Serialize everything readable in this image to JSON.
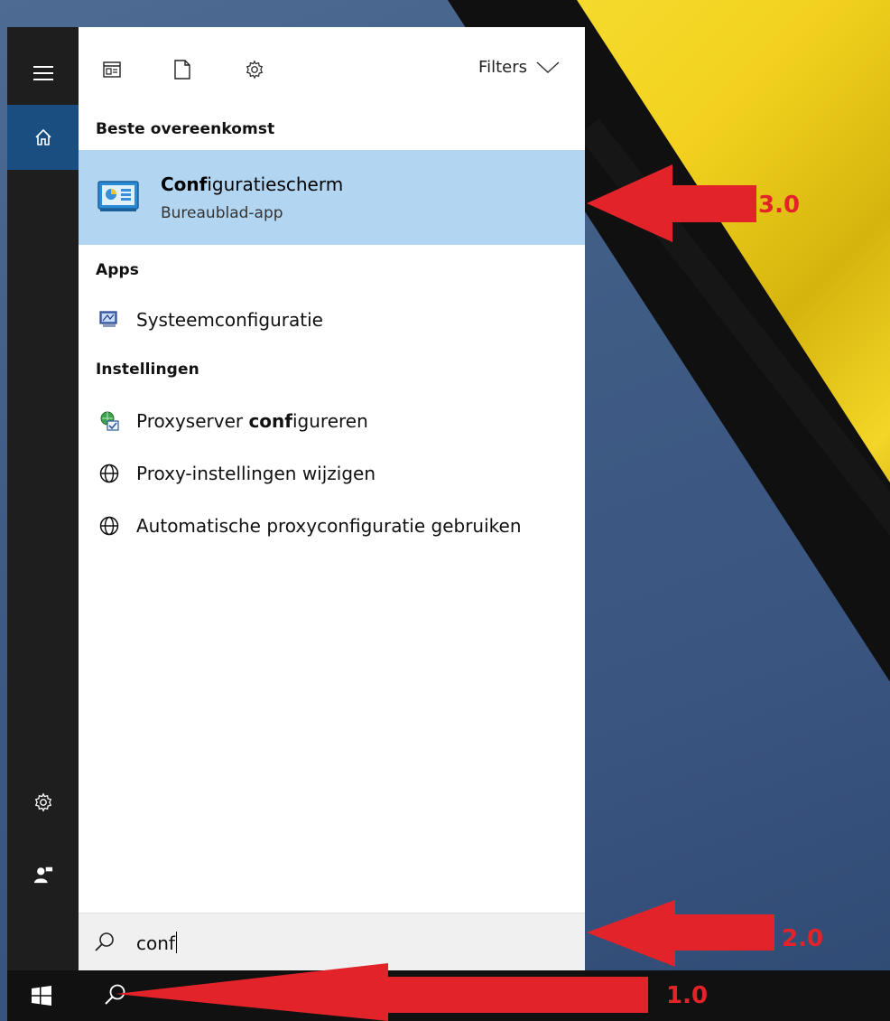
{
  "toolbar": {
    "filters_label": "Filters",
    "icons": [
      "apps-icon",
      "document-icon",
      "gear-icon"
    ]
  },
  "sections": {
    "best_match": "Beste overeenkomst",
    "apps": "Apps",
    "settings": "Instellingen"
  },
  "best_match": {
    "title_bold": "Conf",
    "title_rest": "iguratiescherm",
    "subtitle": "Bureaublad-app",
    "icon": "control-panel-icon",
    "highlight_color": "#b2d6f2"
  },
  "apps": [
    {
      "label": "Systeemconfiguratie",
      "icon": "msconfig-icon"
    }
  ],
  "settings": [
    {
      "label_pre": "Proxyserver ",
      "label_bold": "conf",
      "label_post": "igureren",
      "icon": "network-config-icon"
    },
    {
      "label": "Proxy-instellingen wijzigen",
      "icon": "globe-icon"
    },
    {
      "label": "Automatische proxyconfiguratie gebruiken",
      "icon": "globe-icon"
    }
  ],
  "search": {
    "value": "conf"
  },
  "annotations": {
    "step1": "1.0",
    "step2": "2.0",
    "step3": "3.0",
    "color": "#e3232a"
  },
  "colors": {
    "sidebar": "#1e1e1e",
    "sidebar_active": "#1a4d80",
    "taskbar": "#111111",
    "search_bg": "#f0f0f0"
  }
}
